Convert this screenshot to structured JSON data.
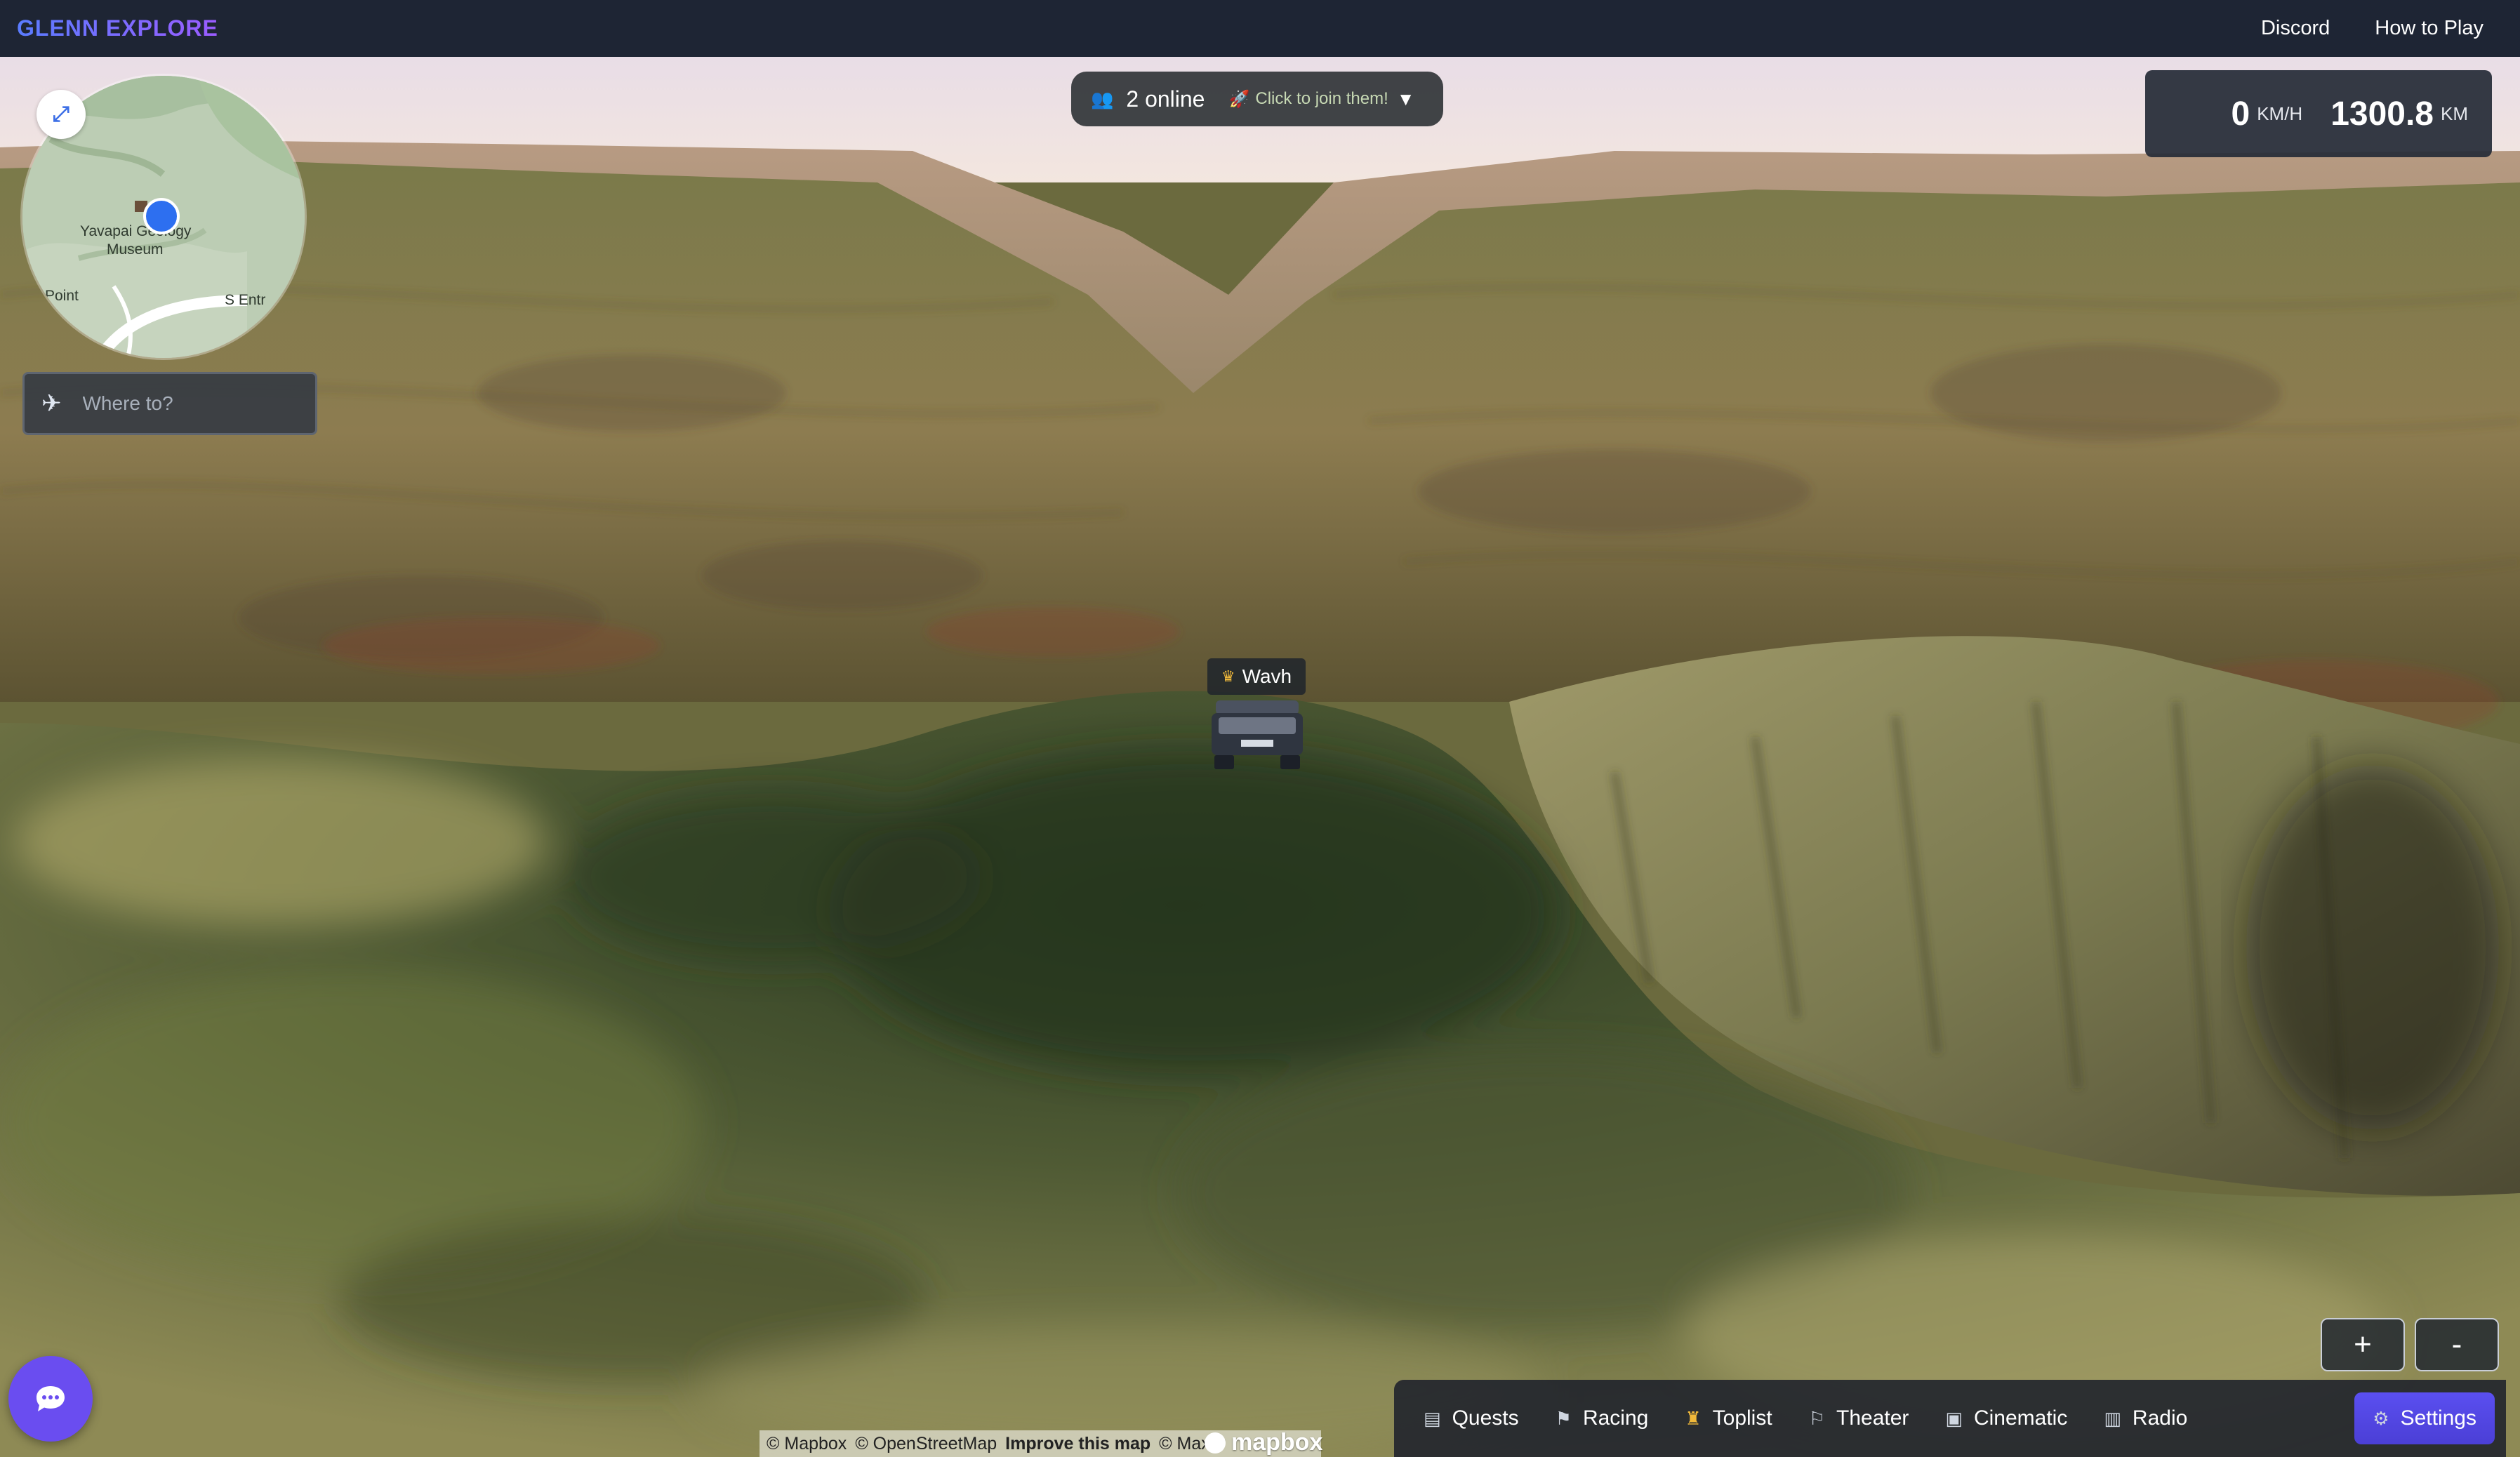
{
  "app": {
    "brand": "GLENN EXPLORE",
    "nav": [
      "Discord",
      "How to Play"
    ]
  },
  "online": {
    "count_label": "2 online",
    "join_label": "Click to join them!",
    "people_icon": "people-icon",
    "rocket_icon": "rocket-icon",
    "caret": "▼"
  },
  "speedometer": {
    "speed_value": "0",
    "speed_unit": "KM/H",
    "distance_value": "1300.8",
    "distance_unit": "KM"
  },
  "minimap": {
    "labels": [
      "Yavapai Geology",
      "Museum",
      "Point",
      "S Entr"
    ],
    "expand_icon": "expand-icon"
  },
  "search": {
    "placeholder": "Where to?",
    "icon": "plane-icon"
  },
  "player": {
    "name": "Wavh",
    "badge_icon": "crown-icon"
  },
  "zoom": {
    "in_label": "+",
    "out_label": "-"
  },
  "toolbar": {
    "items": [
      {
        "label": "Quests",
        "icon": "scroll-icon"
      },
      {
        "label": "Racing",
        "icon": "checkered-flag-icon"
      },
      {
        "label": "Toplist",
        "icon": "trophy-icon"
      },
      {
        "label": "Theater",
        "icon": "clapper-icon"
      },
      {
        "label": "Cinematic",
        "icon": "film-camera-icon"
      },
      {
        "label": "Radio",
        "icon": "radio-icon"
      },
      {
        "label": "Settings",
        "icon": "gear-icon"
      }
    ]
  },
  "attribution": {
    "mapbox": "© Mapbox",
    "osm": "© OpenStreetMap",
    "improve": "Improve this map",
    "maxar": "© Maxar",
    "logo_text": "mapbox"
  },
  "colors": {
    "topbar": "#1e2534",
    "accent": "#5a4ff0",
    "sky": "#e9dde9"
  }
}
